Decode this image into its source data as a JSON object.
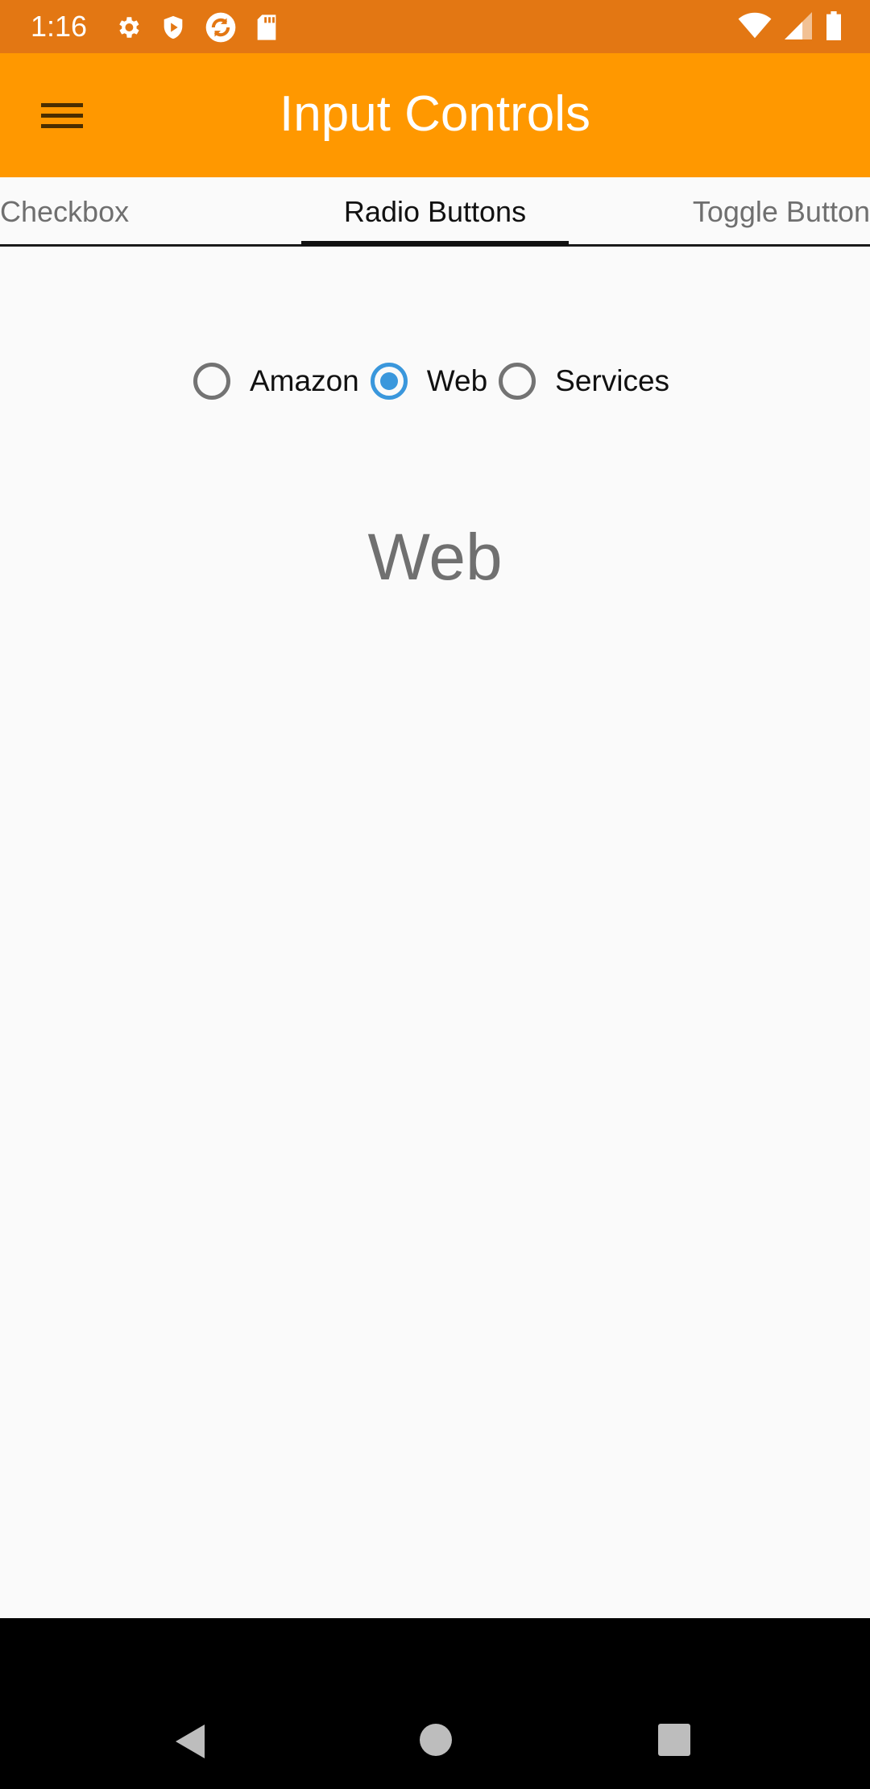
{
  "status_bar": {
    "time": "1:16",
    "left_icons": [
      "gear-icon",
      "shield-play-icon",
      "sync-icon",
      "sd-card-icon"
    ],
    "right_icons": [
      "wifi-icon",
      "cell-signal-icon",
      "battery-icon"
    ],
    "color": "#e37713"
  },
  "app_bar": {
    "title": "Input Controls",
    "color": "#ff9800",
    "menu_icon": "hamburger-menu-icon"
  },
  "tabs": [
    {
      "label": "Checkbox",
      "selected": false
    },
    {
      "label": "Radio Buttons",
      "selected": true
    },
    {
      "label": "Toggle Button",
      "selected": false
    }
  ],
  "radio_group": {
    "options": [
      {
        "label": "Amazon",
        "checked": false
      },
      {
        "label": "Web",
        "checked": true
      },
      {
        "label": "Services",
        "checked": false
      }
    ],
    "accent_color": "#3a97dc"
  },
  "selection_display": "Web",
  "nav_bar": {
    "icons": [
      "back-icon",
      "home-icon",
      "recents-icon"
    ]
  }
}
